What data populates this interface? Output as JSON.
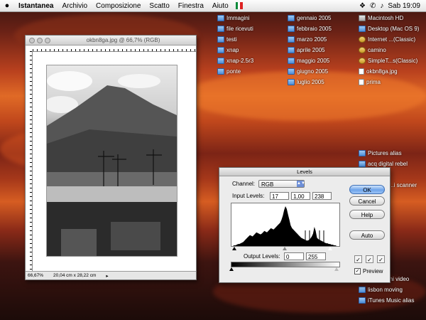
{
  "menubar": {
    "apple": "",
    "items": [
      "Istantanea",
      "Archivio",
      "Composizione",
      "Scatto",
      "Finestra",
      "Aiuto"
    ],
    "clock": "Sab 19:09"
  },
  "desktop": {
    "col1": [
      "Immagini",
      "file ricevuti",
      "testi",
      "xnap",
      "xnap-2.5r3",
      "ponte"
    ],
    "col2": [
      "gennaio 2005",
      "febbraio 2005",
      "marzo 2005",
      "aprile 2005",
      "maggio 2005",
      "giugno 2005",
      "luglio 2005"
    ],
    "col3": [
      "Macintosh HD",
      "Desktop (Mac OS 9)",
      "Internet ...(Classic)",
      "camino",
      "SimpleT...s(Classic)",
      "okbn8ga.jpg",
      "prima"
    ],
    "col4": [
      "Pictures alias",
      "acq digital rebel",
      "...i scanner",
      "...ni video",
      "lisbon moving",
      "iTunes Music alias"
    ]
  },
  "image_window": {
    "title": "okbn8ga.jpg @ 66,7% (RGB)",
    "zoom": "66,67%",
    "doc_size": "20,04 cm x 28,22 cm"
  },
  "levels": {
    "title": "Levels",
    "channel_label": "Channel:",
    "channel_value": "RGB",
    "input_label": "Input Levels:",
    "input_values": [
      "17",
      "1,00",
      "238"
    ],
    "output_label": "Output Levels:",
    "output_values": [
      "0",
      "255"
    ],
    "buttons": {
      "ok": "OK",
      "cancel": "Cancel",
      "help": "Help",
      "auto": "Auto"
    },
    "preview_label": "Preview",
    "preview_checked": true,
    "histogram": [
      0,
      0,
      1,
      1,
      2,
      3,
      3,
      4,
      5,
      6,
      8,
      10,
      12,
      14,
      16,
      15,
      14,
      16,
      18,
      20,
      19,
      18,
      17,
      18,
      20,
      22,
      21,
      20,
      22,
      24,
      26,
      25,
      24,
      26,
      28,
      30,
      32,
      34,
      38,
      44,
      52,
      58,
      54,
      46,
      38,
      30,
      26,
      24,
      22,
      20,
      18,
      16,
      14,
      12,
      11,
      10,
      9,
      8,
      8,
      9,
      11,
      14,
      18,
      28,
      22,
      12,
      10,
      9,
      8,
      7,
      6,
      5,
      4,
      4,
      3,
      3,
      2,
      2,
      1,
      1,
      0,
      0
    ]
  }
}
